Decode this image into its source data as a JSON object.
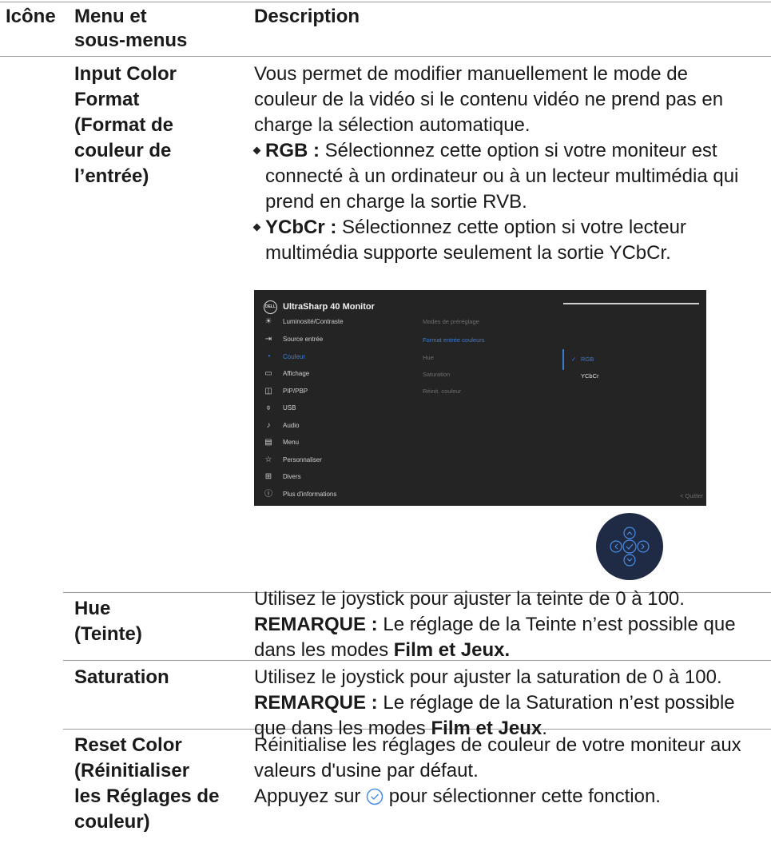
{
  "header": {
    "icon_col": "Icône",
    "menu_col_line1": "Menu et",
    "menu_col_line2": "sous-menus",
    "desc_col": "Description"
  },
  "rows": {
    "input_color": {
      "menu_lines": [
        "Input Color",
        "Format",
        "(Format de",
        "couleur de",
        "l’entrée)"
      ],
      "desc_lines": [
        "Vous permet de modifier manuellement le mode de",
        "couleur de la vidéo si le contenu vidéo ne prend pas en",
        "charge la sélection automatique."
      ],
      "bullet_rgb_label": "RGB :",
      "bullet_rgb_lines": [
        " Sélectionnez cette option si votre moniteur est",
        "connecté à un ordinateur ou à un lecteur multimédia qui",
        "prend en charge la sortie RVB."
      ],
      "bullet_ycbcr_label": "YCbCr :",
      "bullet_ycbcr_lines": [
        " Sélectionnez cette option si votre lecteur",
        "multimédia supporte seulement la sortie YCbCr."
      ]
    },
    "hue": {
      "menu_line1": "Hue",
      "menu_line2": "(Teinte)",
      "desc_line1": "Utilisez le joystick pour ajuster la teinte de 0 à 100.",
      "note_label": "REMARQUE :",
      "note_text1": " Le réglage de la Teinte n’est possible que",
      "note_text2a": "dans les modes ",
      "note_text2b": "Film et Jeux."
    },
    "saturation": {
      "menu_line1": "Saturation",
      "desc_line1": "Utilisez le joystick pour ajuster la saturation de 0 à 100.",
      "note_label": "REMARQUE :",
      "note_text1": " Le réglage de la Saturation n’est possible",
      "note_text2a": "que dans les modes ",
      "note_text2b": "Film et Jeux",
      "note_text2c": "."
    },
    "reset": {
      "menu_lines": [
        "Reset Color",
        "(Réinitialiser",
        "les Réglages de",
        "couleur)"
      ],
      "desc_line1": "Réinitialise les réglages de couleur de votre moniteur aux",
      "desc_line2": "valeurs d'usine par défaut.",
      "desc_line3a": "Appuyez sur ",
      "desc_line3b": " pour sélectionner cette fonction."
    }
  },
  "osd": {
    "logo": "DELL",
    "title": "UltraSharp 40 Monitor",
    "menu": [
      {
        "label": "Luminosité/Contraste",
        "icon": "brightness-icon",
        "glyph": "☀"
      },
      {
        "label": "Source entrée",
        "icon": "input-source-icon",
        "glyph": "⇥"
      },
      {
        "label": "Couleur",
        "icon": "color-icon",
        "glyph": "◔"
      },
      {
        "label": "Affichage",
        "icon": "display-icon",
        "glyph": "▭"
      },
      {
        "label": "PIP/PBP",
        "icon": "pip-icon",
        "glyph": "◫"
      },
      {
        "label": "USB",
        "icon": "usb-icon",
        "glyph": "⌽"
      },
      {
        "label": "Audio",
        "icon": "audio-icon",
        "glyph": "♪"
      },
      {
        "label": "Menu",
        "icon": "menu-icon",
        "glyph": "▤"
      },
      {
        "label": "Personnaliser",
        "icon": "star-icon",
        "glyph": "☆"
      },
      {
        "label": "Divers",
        "icon": "misc-icon",
        "glyph": "⊞"
      },
      {
        "label": "Plus d'informations",
        "icon": "info-icon",
        "glyph": "ⓘ"
      }
    ],
    "submenu": [
      "Modes de préréglage",
      "Format entrée couleurs",
      "Hue",
      "Saturation",
      "Réinit. couleur"
    ],
    "options": [
      "RGB",
      "YCbCr"
    ],
    "selected_option": "RGB",
    "checkmark": "✓",
    "quit": "< Quitter",
    "accent_color": "#3b7bd4"
  }
}
